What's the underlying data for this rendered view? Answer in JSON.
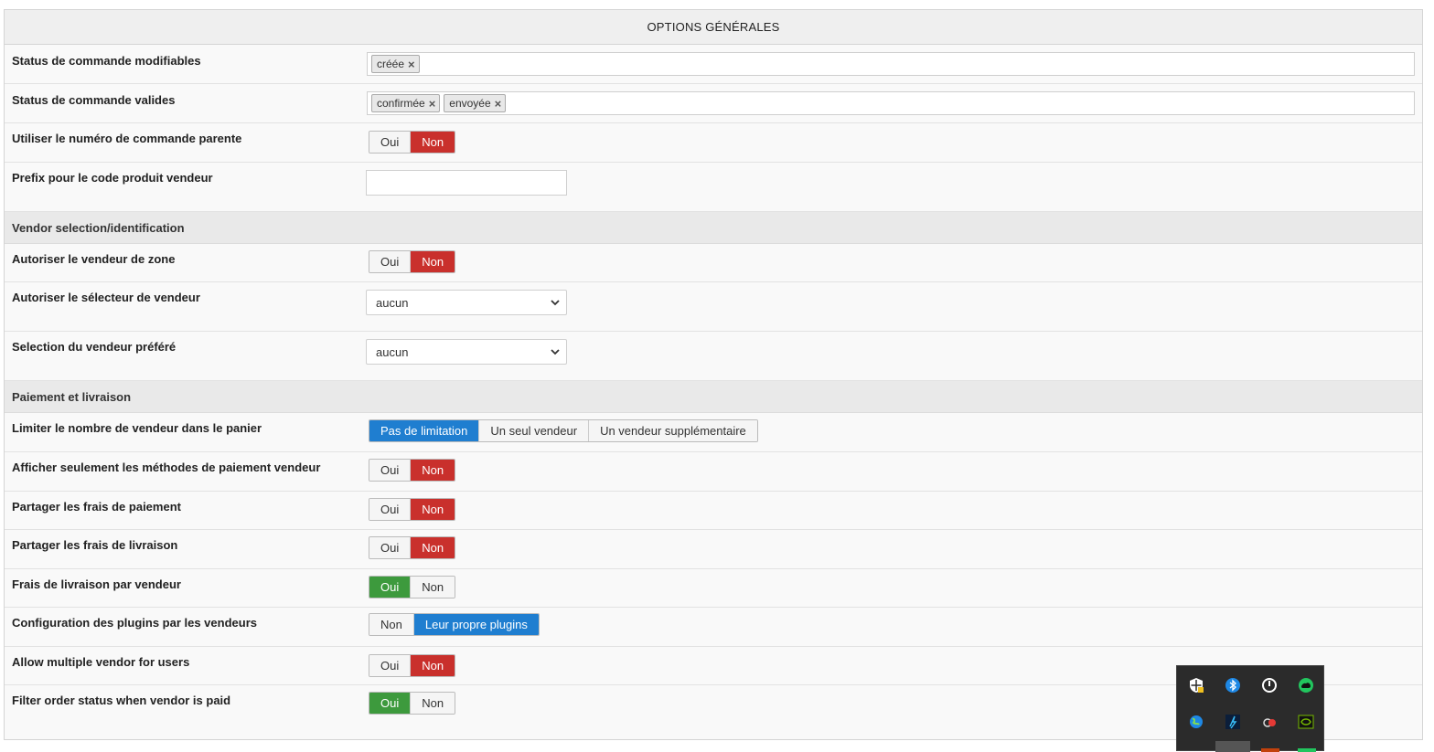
{
  "panel": {
    "title": "OPTIONS GÉNÉRALES"
  },
  "rows": {
    "editable_status": {
      "label": "Status de commande modifiables",
      "tags": [
        "créée"
      ]
    },
    "valid_status": {
      "label": "Status de commande valides",
      "tags": [
        "confirmée",
        "envoyée"
      ]
    },
    "parent_order": {
      "label": "Utiliser le numéro de commande parente",
      "options": [
        "Oui",
        "Non"
      ],
      "selected": "Non"
    },
    "prefix": {
      "label": "Prefix pour le code produit vendeur",
      "value": ""
    },
    "zone_vendor": {
      "label": "Autoriser le vendeur de zone",
      "options": [
        "Oui",
        "Non"
      ],
      "selected": "Non"
    },
    "vendor_selector": {
      "label": "Autoriser le sélecteur de vendeur",
      "value": "aucun"
    },
    "preferred_vendor": {
      "label": "Selection du vendeur préféré",
      "value": "aucun"
    },
    "limit_vendors": {
      "label": "Limiter le nombre de vendeur dans le panier",
      "options": [
        "Pas de limitation",
        "Un seul vendeur",
        "Un vendeur supplémentaire"
      ],
      "selected": "Pas de limitation"
    },
    "payment_methods": {
      "label": "Afficher seulement les méthodes de paiement vendeur",
      "options": [
        "Oui",
        "Non"
      ],
      "selected": "Non"
    },
    "share_payment": {
      "label": "Partager les frais de paiement",
      "options": [
        "Oui",
        "Non"
      ],
      "selected": "Non"
    },
    "share_shipping": {
      "label": "Partager les frais de livraison",
      "options": [
        "Oui",
        "Non"
      ],
      "selected": "Non"
    },
    "shipping_per_vendor": {
      "label": "Frais de livraison par vendeur",
      "options": [
        "Oui",
        "Non"
      ],
      "selected": "Oui"
    },
    "plugins_config": {
      "label": "Configuration des plugins par les vendeurs",
      "options": [
        "Non",
        "Leur propre plugins"
      ],
      "selected": "Leur propre plugins"
    },
    "multiple_vendor": {
      "label": "Allow multiple vendor for users",
      "options": [
        "Oui",
        "Non"
      ],
      "selected": "Non"
    },
    "filter_status": {
      "label": "Filter order status when vendor is paid",
      "options": [
        "Oui",
        "Non"
      ],
      "selected": "Oui"
    }
  },
  "sections": {
    "vendor_selection": "Vendor selection/identification",
    "payment_shipping": "Paiement et livraison"
  },
  "tray": {
    "icons": [
      "security-icon",
      "bluetooth-icon",
      "power-icon",
      "nvidia-cloud-icon",
      "globe-icon",
      "wifi-app-icon",
      "chat-icon",
      "nvidia-icon"
    ]
  }
}
